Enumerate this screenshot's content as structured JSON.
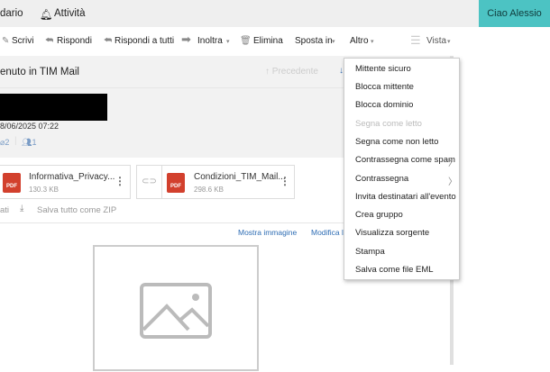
{
  "topbar": {
    "calendar": "dario",
    "activity": "Attività",
    "greeting": "Ciao Alessio"
  },
  "toolbar": {
    "compose": "Scrivi",
    "reply": "Rispondi",
    "reply_all": "Rispondi a tutti",
    "forward": "Inoltra",
    "delete": "Elimina",
    "move": "Sposta in",
    "more": "Altro",
    "view": "Vista"
  },
  "message": {
    "subject": "enuto in TIM Mail",
    "previous": "Precedente",
    "date": "8/06/2025 07:22",
    "attach_count": "2",
    "recipient_count": "1"
  },
  "attachments": [
    {
      "name": "Informativa_Privacy...",
      "size": "130.3 KB"
    },
    {
      "name": "Condizioni_TIM_Mail...",
      "size": "298.6 KB"
    }
  ],
  "actions": {
    "partial": "ati",
    "save_zip": "Salva tutto come ZIP",
    "show_image": "Mostra immagine",
    "edit": "Modifica l"
  },
  "menu": [
    {
      "label": "Mittente sicuro"
    },
    {
      "label": "Blocca mittente"
    },
    {
      "label": "Blocca dominio"
    },
    {
      "label": "Segna come letto",
      "disabled": true
    },
    {
      "label": "Segna come non letto"
    },
    {
      "label": "Contrassegna come spam",
      "submenu": true
    },
    {
      "label": "Contrassegna",
      "submenu": true
    },
    {
      "label": "Invita destinatari all'evento"
    },
    {
      "label": "Crea gruppo"
    },
    {
      "label": "Visualizza sorgente"
    },
    {
      "label": "Stampa"
    },
    {
      "label": "Salva come file EML"
    }
  ]
}
